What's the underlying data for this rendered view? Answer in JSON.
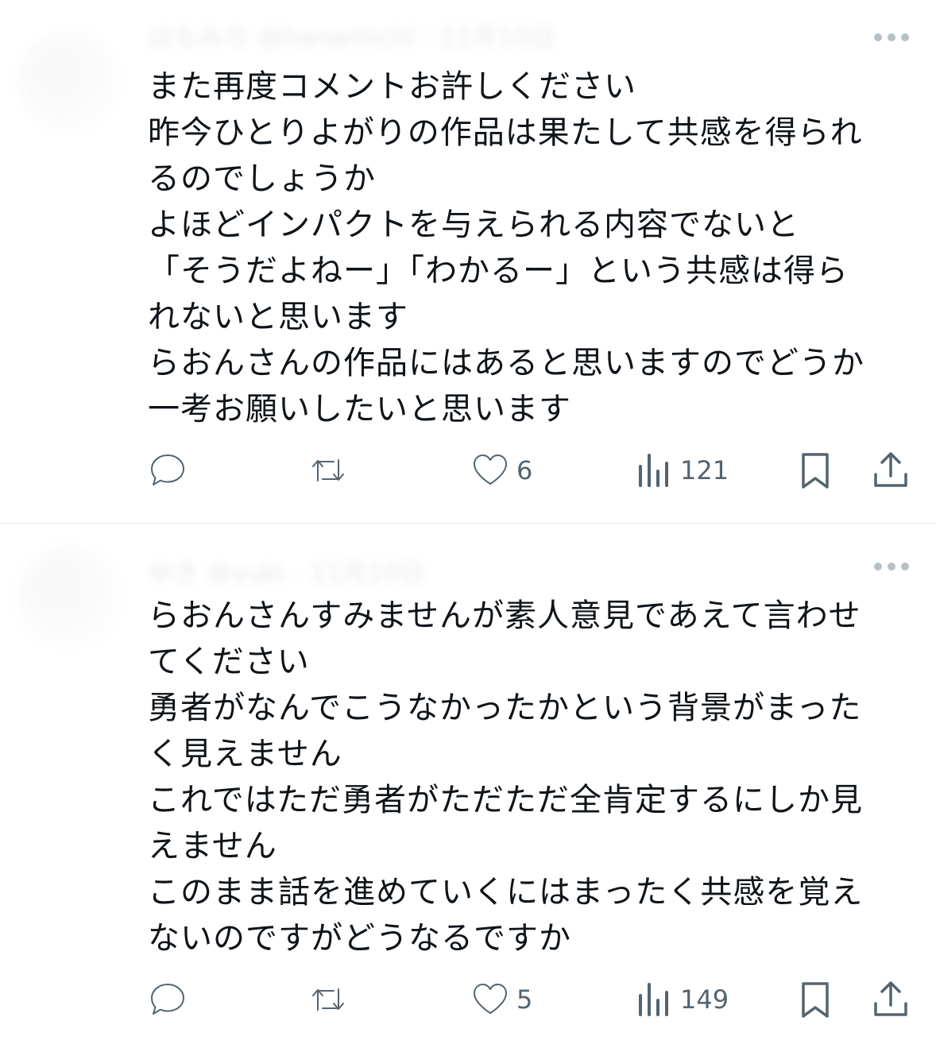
{
  "posts": [
    {
      "header_blurred": "はなみち @hanamichi · 11月10日",
      "lines": [
        "また再度コメントお許しください",
        "昨今ひとりよがりの作品は果たして共感を得られ",
        "るのでしょうか",
        "よほどインパクトを与えられる内容でないと",
        "「そうだよねー」「わかるー」という共感は得ら",
        "れないと思います",
        "らおんさんの作品にはあると思いますのでどうか",
        "一考お願いしたいと思います"
      ],
      "actions": {
        "like_count": "6",
        "views_count": "121"
      }
    },
    {
      "header_blurred": "ゆき @yuki · 11月10日",
      "lines": [
        "らおんさんすみませんが素人意見であえて言わせ",
        "てください",
        "勇者がなんでこうなかったかという背景がまった",
        "く見えません",
        "これではただ勇者がただただ全肯定するにしか見",
        "えません",
        "このまま話を進めていくにはまったく共感を覚え",
        "ないのですがどうなるですか"
      ],
      "actions": {
        "like_count": "5",
        "views_count": "149"
      }
    }
  ],
  "icons": {
    "more": "more-dots-icon",
    "reply": "reply-bubble-icon",
    "repost": "repost-arrows-icon",
    "like": "heart-icon",
    "views": "views-chart-icon",
    "bookmark": "bookmark-icon",
    "share": "share-upload-icon"
  },
  "colors": {
    "text": "#0f1419",
    "icon": "#536471",
    "divider": "#eff3f4"
  }
}
